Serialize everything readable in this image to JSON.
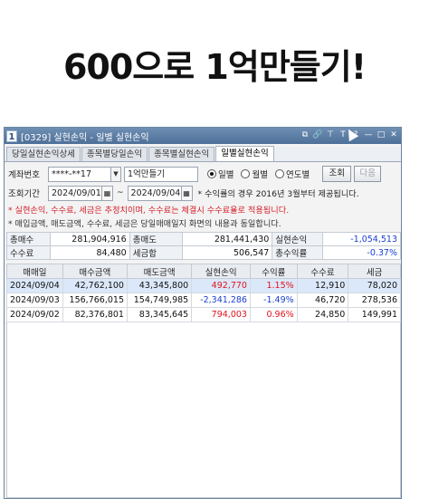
{
  "headline": "600으로 1억만들기!",
  "window": {
    "number": "1",
    "title": "[0329] 실현손익 - 일별 실현손익",
    "title_icons": [
      "window-icon",
      "link-icon",
      "pin-icon",
      "font-icon",
      "help-icon",
      "minimize-icon",
      "maximize-icon",
      "close-icon"
    ],
    "title_icon_glyphs": [
      "⧉",
      "🔗",
      "⊤",
      "T",
      "?",
      "—",
      "□",
      "✕"
    ]
  },
  "tabs": [
    "당일실현손익상세",
    "종목별당일손익",
    "종목별실현손익",
    "일별실현손익"
  ],
  "active_tab": 3,
  "form": {
    "account_label": "계좌번호",
    "account_value": "****-**17",
    "account_name": "1억만들기",
    "radios": [
      {
        "label": "일별",
        "checked": true
      },
      {
        "label": "월별",
        "checked": false
      },
      {
        "label": "연도별",
        "checked": false
      }
    ],
    "query_button": "조회",
    "next_button": "다음",
    "period_label": "조회기간",
    "start_date": "2024/09/01",
    "tilde": "~",
    "end_date": "2024/09/04",
    "period_note": "* 수익률의 경우 2016년 3월부터 제공됩니다."
  },
  "notes": {
    "red": "* 실현손익, 수수료, 세금은 추정치이며, 수수료는 체결시 수수료율로 적용됩니다.",
    "dark": "* 매입금액, 매도금액, 수수료, 세금은 당일매매일지 화면의 내용과 동일합니다."
  },
  "summary": {
    "rows": [
      [
        {
          "k": "총매수",
          "v": "281,904,916"
        },
        {
          "k": "총매도",
          "v": "281,441,430"
        },
        {
          "k": "실현손익",
          "v": "-1,054,513",
          "color": "blue"
        }
      ],
      [
        {
          "k": "수수료",
          "v": "84,480"
        },
        {
          "k": "세금합",
          "v": "506,547"
        },
        {
          "k": "총수익률",
          "v": "-0.37%",
          "color": "blue"
        }
      ]
    ]
  },
  "grid": {
    "headers": [
      "매매일",
      "매수금액",
      "매도금액",
      "실현손익",
      "수익률",
      "수수료",
      "세금"
    ],
    "rows": [
      {
        "cells": [
          "2024/09/04",
          "42,762,100",
          "43,345,800",
          "492,770",
          "1.15%",
          "12,910",
          "78,020"
        ],
        "color": "red",
        "selected": true
      },
      {
        "cells": [
          "2024/09/03",
          "156,766,015",
          "154,749,985",
          "-2,341,286",
          "-1.49%",
          "46,720",
          "278,536"
        ],
        "color": "blue",
        "selected": false
      },
      {
        "cells": [
          "2024/09/02",
          "82,376,801",
          "83,345,645",
          "794,003",
          "0.96%",
          "24,850",
          "149,991"
        ],
        "color": "red",
        "selected": false
      }
    ]
  },
  "colors": {
    "profit": "#e0131d",
    "loss": "#1a3fd0",
    "selected_row": "#dbe8f9",
    "titlebar": "#5a7ba4"
  }
}
